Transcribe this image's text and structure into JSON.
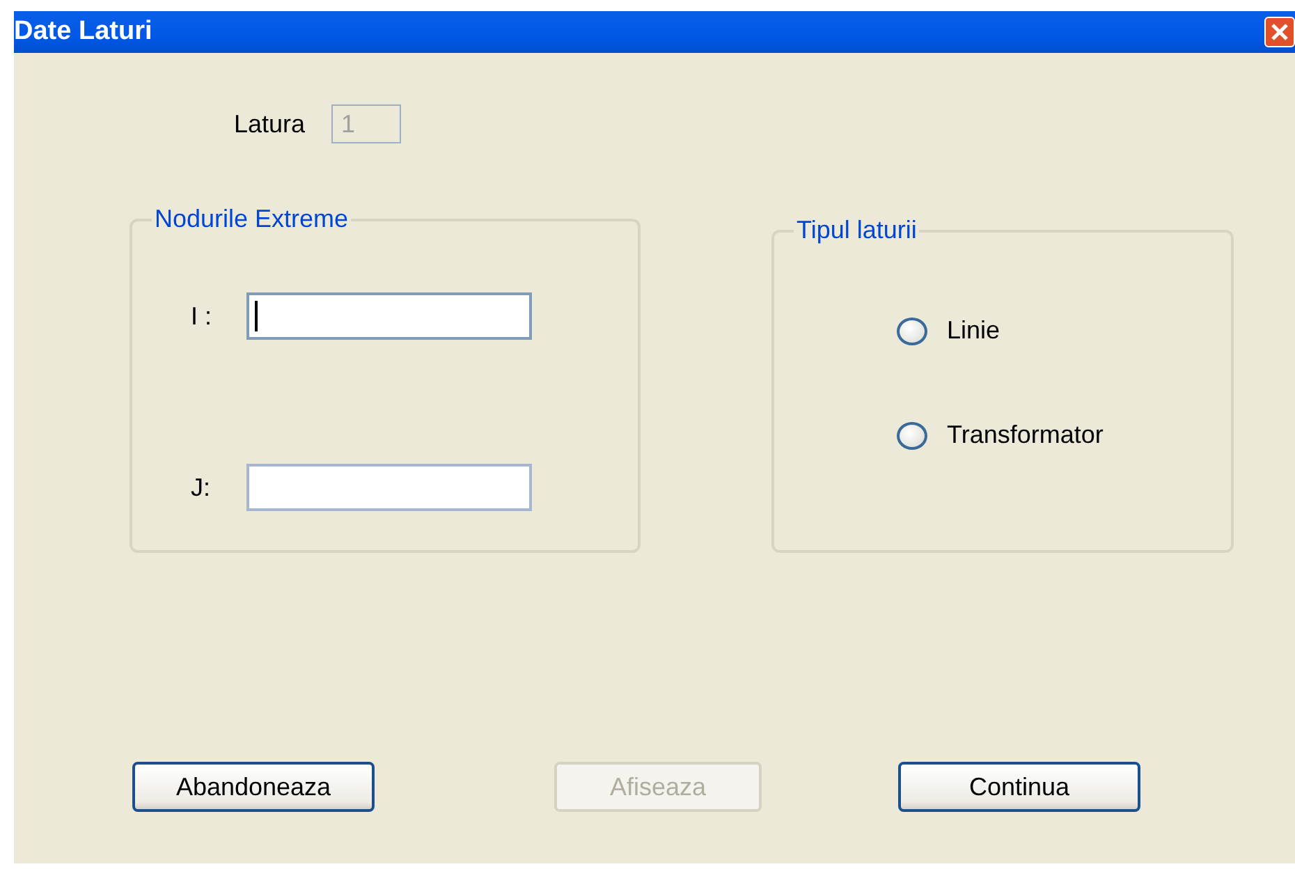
{
  "window": {
    "title": "Date Laturi"
  },
  "latura": {
    "label": "Latura",
    "value": "1",
    "disabled": true
  },
  "nodes_group": {
    "title": "Nodurile Extreme",
    "fields": [
      {
        "label": "I :",
        "focused": true
      },
      {
        "label": "J:",
        "focused": false
      }
    ]
  },
  "type_group": {
    "title": "Tipul laturii",
    "options": [
      {
        "label": "Linie",
        "selected": false
      },
      {
        "label": "Transformator",
        "selected": false
      }
    ]
  },
  "buttons": [
    {
      "label": "Abandoneaza",
      "disabled": false
    },
    {
      "label": "Afiseaza",
      "disabled": true
    },
    {
      "label": "Continua",
      "disabled": false
    }
  ]
}
